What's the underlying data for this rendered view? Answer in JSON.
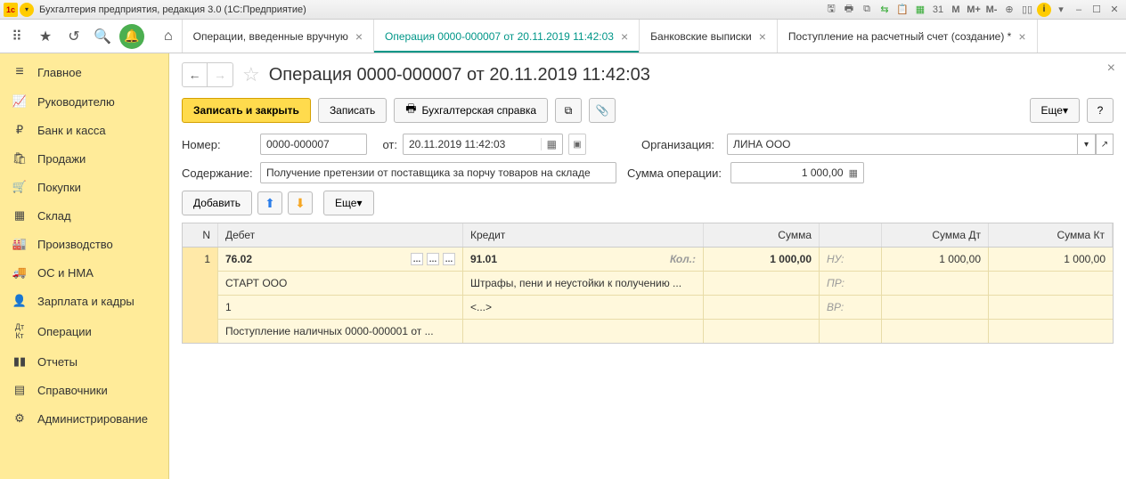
{
  "titlebar": {
    "title": "Бухгалтерия предприятия, редакция 3.0  (1С:Предприятие)",
    "m": "M",
    "m_plus": "M+",
    "m_minus": "M-",
    "cal": "31"
  },
  "tabs": {
    "t1": "Операции, введенные вручную",
    "t2": "Операция 0000-000007 от 20.11.2019 11:42:03",
    "t3": "Банковские выписки",
    "t4": "Поступление на расчетный счет (создание) *"
  },
  "sidebar": {
    "main": "Главное",
    "ruk": "Руководителю",
    "bank": "Банк и касса",
    "sales": "Продажи",
    "purch": "Покупки",
    "stock": "Склад",
    "prod": "Производство",
    "os": "ОС и НМА",
    "zp": "Зарплата и кадры",
    "ops": "Операции",
    "reports": "Отчеты",
    "spr": "Справочники",
    "admin": "Администрирование"
  },
  "doc": {
    "title": "Операция 0000-000007 от 20.11.2019 11:42:03",
    "save_close": "Записать и закрыть",
    "save": "Записать",
    "print_ref": "Бухгалтерская справка",
    "more": "Еще",
    "number_label": "Номер:",
    "number": "0000-000007",
    "from": "от:",
    "date": "20.11.2019 11:42:03",
    "org_label": "Организация:",
    "org": "ЛИНА ООО",
    "content_label": "Содержание:",
    "content": "Получение претензии от поставщика за порчу товаров на складе",
    "sum_op_label": "Сумма операции:",
    "sum_op": "1 000,00",
    "add": "Добавить"
  },
  "table": {
    "headers": {
      "n": "N",
      "debit": "Дебет",
      "credit": "Кредит",
      "sum": "Сумма",
      "sum_dt": "Сумма Дт",
      "sum_kt": "Сумма Кт"
    },
    "row1": {
      "n": "1",
      "debit_acc": "76.02",
      "debit_sub1": "СТАРТ ООО",
      "debit_sub2": "1",
      "debit_sub3": "Поступление наличных 0000-000001 от ...",
      "credit_acc": "91.01",
      "credit_kol": "Кол.:",
      "credit_sub1": "Штрафы, пени и неустойки к получению ...",
      "credit_sub2": "<...>",
      "sum": "1 000,00",
      "nu": "НУ:",
      "pr": "ПР:",
      "vr": "ВР:",
      "sum_dt": "1 000,00",
      "sum_kt": "1 000,00"
    }
  }
}
